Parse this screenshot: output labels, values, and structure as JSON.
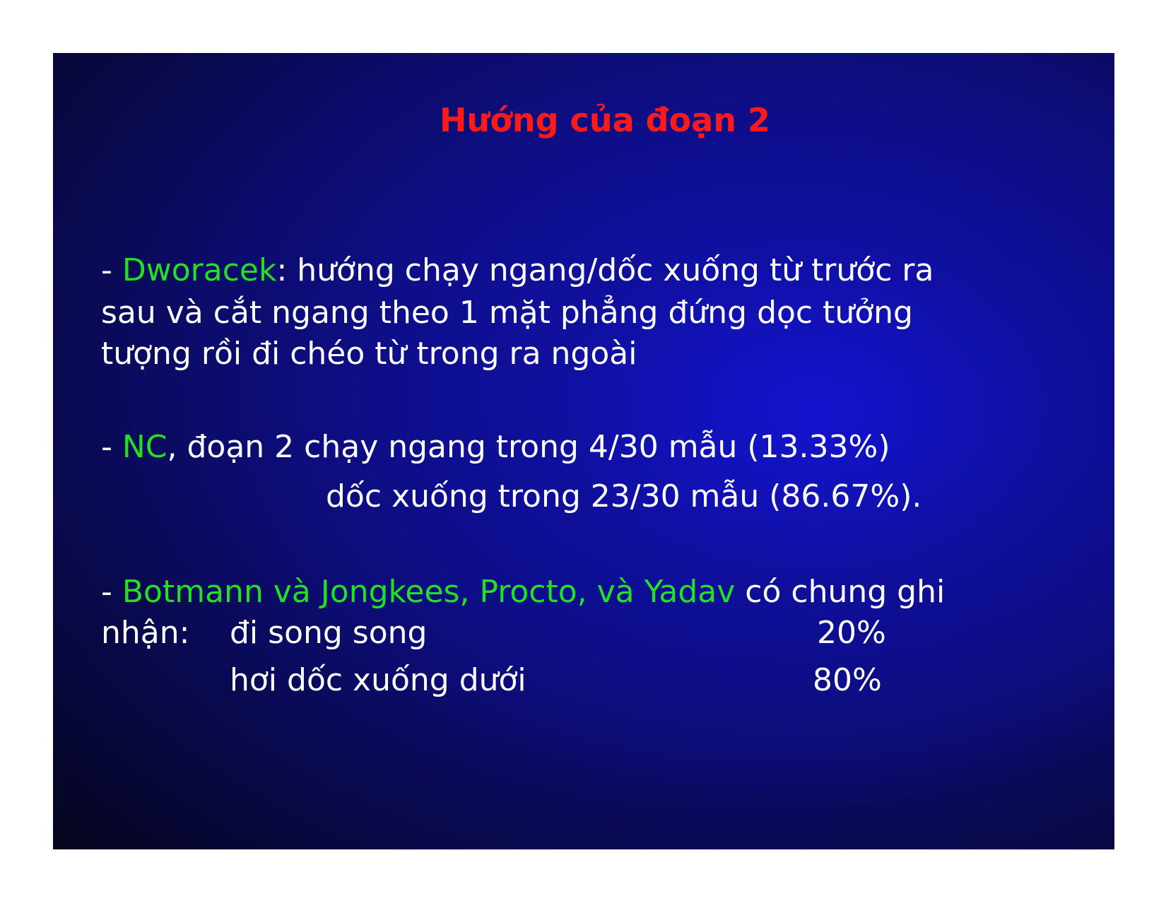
{
  "slide": {
    "title": "Hướng của đoạn 2",
    "block1": {
      "dash": "- ",
      "name": "Dworacek",
      "line1_rest": ": hướng chạy ngang/dốc xuống từ trước ra",
      "line2": "sau và cắt ngang theo 1 mặt phẳng đứng dọc tưởng",
      "line3": "tượng rồi đi chéo từ trong ra ngoài"
    },
    "block2": {
      "dash": "- ",
      "name": "NC",
      "line1_rest": ", đoạn 2 chạy ngang trong 4/30 mẫu (13.33%)",
      "line2": "dốc xuống trong 23/30 mẫu (86.67%)."
    },
    "block3": {
      "dash": "- ",
      "names": "Botmann và Jongkees, Procto, và Yadav",
      "line1_rest": " có chung ghi",
      "prefix": "nhận:",
      "rows": [
        {
          "label": "đi song song",
          "value": "20%"
        },
        {
          "label": "hơi dốc xuống dưới",
          "value": "80%"
        }
      ]
    }
  },
  "colors": {
    "title": "#ff1a1a",
    "highlight": "#22e022",
    "text": "#ffffff",
    "background": "#0c0c6e"
  }
}
